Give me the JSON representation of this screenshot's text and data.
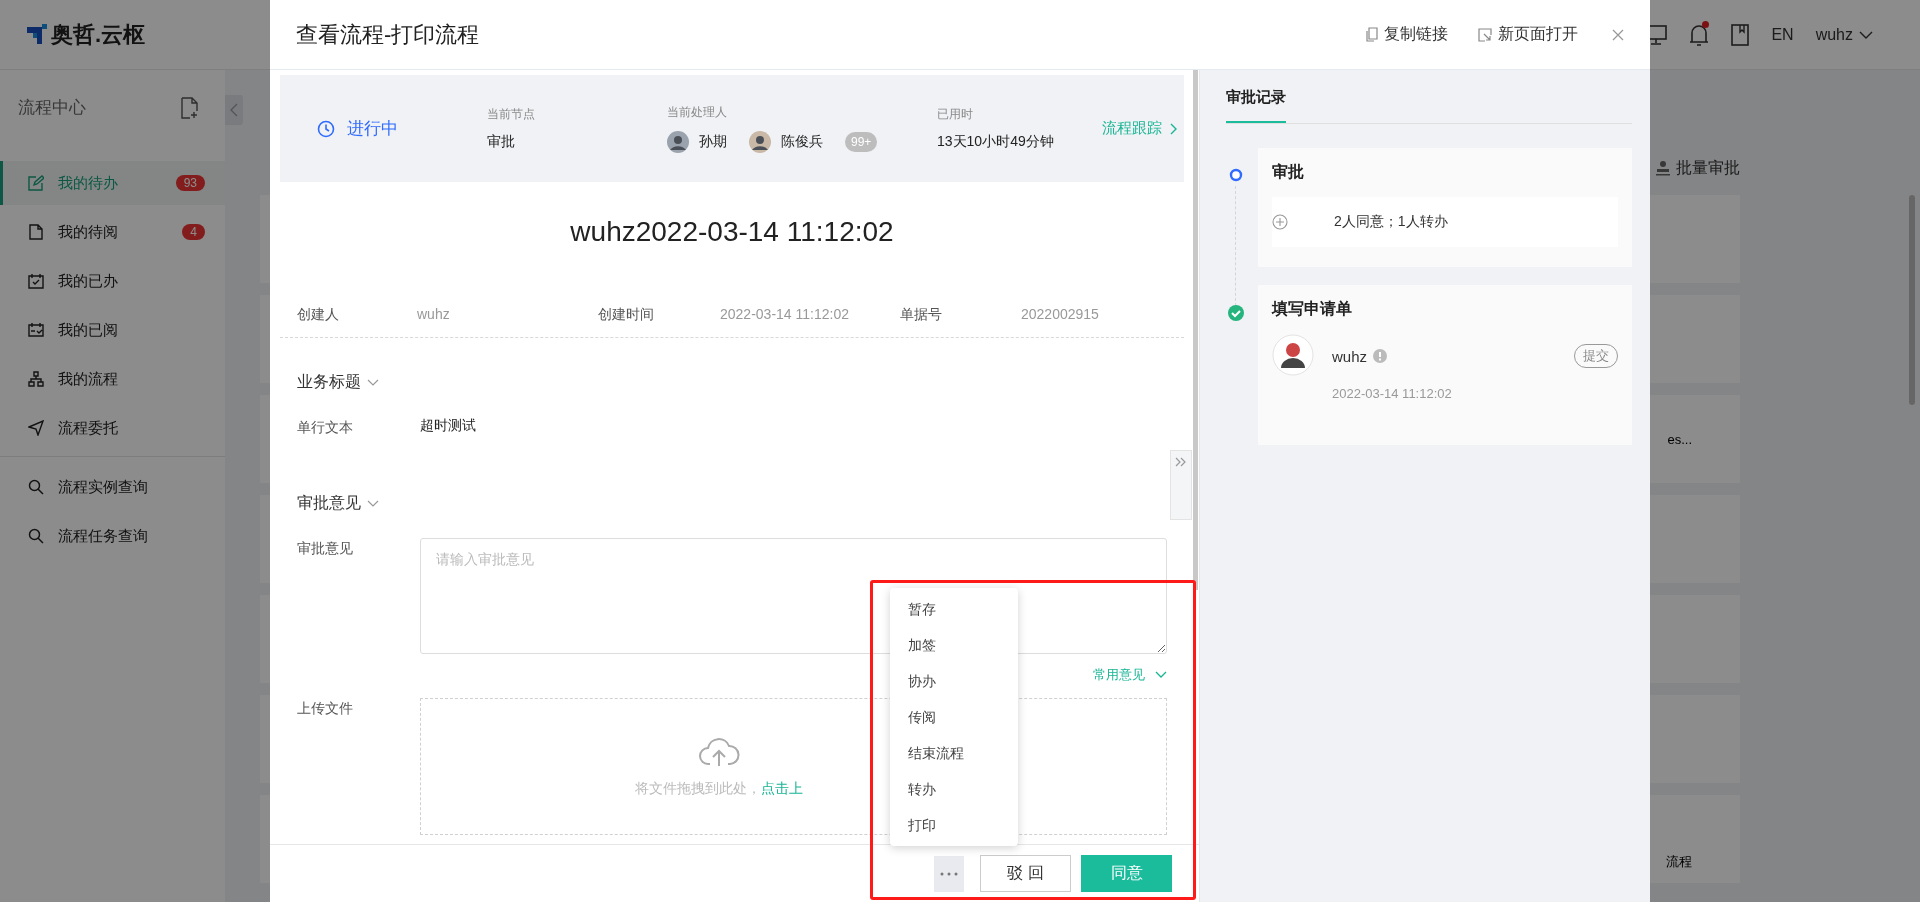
{
  "topbar": {
    "logo": "奥哲.云枢",
    "notification_unread": true,
    "language": "EN",
    "user": "wuhz"
  },
  "sidebar": {
    "title": "流程中心",
    "items": [
      {
        "label": "我的待办",
        "badge": "93",
        "selected": true
      },
      {
        "label": "我的待阅",
        "badge": "4",
        "selected": false
      },
      {
        "label": "我的已办",
        "selected": false
      },
      {
        "label": "我的已阅",
        "selected": false
      },
      {
        "label": "我的流程",
        "selected": false
      },
      {
        "label": "流程委托",
        "selected": false
      }
    ],
    "queries": [
      {
        "label": "流程实例查询",
        "selected": false
      },
      {
        "label": "流程任务查询",
        "selected": false
      }
    ]
  },
  "background": {
    "batch_approve": "批量审批",
    "card_texts": [
      "es...",
      "流程"
    ]
  },
  "dialog": {
    "title": "查看流程-打印流程",
    "actions": [
      "复制链接",
      "新页面打开"
    ],
    "status": "进行中",
    "current_node": {
      "label": "当前节点",
      "value": "审批"
    },
    "handlers": {
      "label": "当前处理人",
      "people": [
        "孙期",
        "陈俊兵"
      ],
      "more": "99+"
    },
    "elapsed": {
      "label": "已用时",
      "value": "13天10小时49分钟"
    },
    "trace_link": "流程跟踪",
    "form_title": "wuhz2022-03-14 11:12:02",
    "meta": [
      {
        "label": "创建人",
        "value": "wuhz"
      },
      {
        "label": "创建时间",
        "value": "2022-03-14 11:12:02"
      },
      {
        "label": "单据号",
        "value": "2022002915"
      }
    ],
    "sections": [
      {
        "title": "业务标题",
        "expanded": true,
        "kind": "fields",
        "rows": [
          {
            "label": "单行文本",
            "value": "超时测试"
          }
        ]
      },
      {
        "title": "审批意见",
        "expanded": true,
        "kind": "opinion",
        "opinion_label": "审批意见",
        "placeholder": "请输入审批意见",
        "common_link": "常用意见",
        "upload_label": "上传文件",
        "upload_hint": "将文件拖拽到此处，",
        "upload_link": "点击上"
      }
    ],
    "more_menu": {
      "expanded": true,
      "items": [
        "暂存",
        "加签",
        "协办",
        "传阅",
        "结束流程",
        "转办",
        "打印"
      ]
    },
    "buttons": {
      "reject": "驳 回",
      "approve": "同意"
    },
    "record_tab": {
      "label": "审批记录",
      "selected": true
    },
    "timeline": [
      {
        "title": "审批",
        "kind": "current",
        "summary": "2人同意；1人转办"
      },
      {
        "title": "填写申请单",
        "kind": "done",
        "user": "wuhz",
        "action": "提交",
        "time": "2022-03-14 11:12:02"
      }
    ]
  }
}
